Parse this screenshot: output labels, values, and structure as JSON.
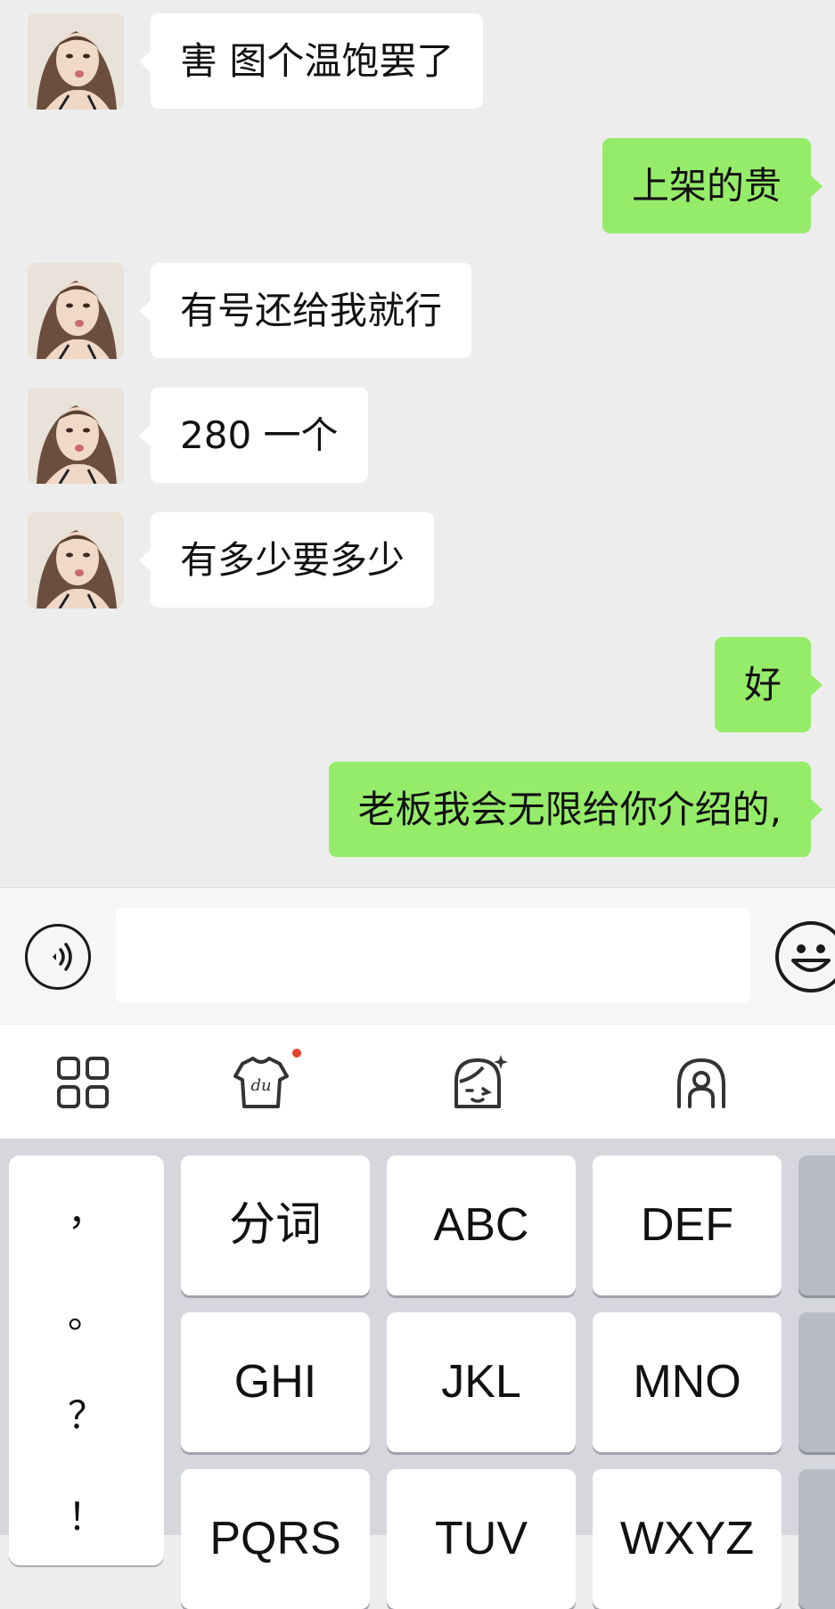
{
  "messages": [
    {
      "side": "in",
      "text": "害 图个温饱罢了"
    },
    {
      "side": "out",
      "text": "上架的贵"
    },
    {
      "side": "in",
      "text": "有号还给我就行"
    },
    {
      "side": "in",
      "text": "280 一个"
    },
    {
      "side": "in",
      "text": "有多少要多少"
    },
    {
      "side": "out",
      "text": "好"
    },
    {
      "side": "out",
      "text": "老板我会无限给你介绍的,"
    }
  ],
  "input": {
    "value": "",
    "voice_icon": "voice-input-icon",
    "emoji_icon": "emoji-icon"
  },
  "keyboard_toolbar": {
    "items": [
      "apps-grid-icon",
      "du-skin-icon",
      "face-sticker-icon",
      "ime-logo-icon"
    ],
    "badge_color": "#e2452e"
  },
  "keyboard": {
    "punctuation": [
      "，",
      "。",
      "？",
      "！"
    ],
    "keys": [
      [
        "分词",
        "ABC",
        "DEF"
      ],
      [
        "GHI",
        "JKL",
        "MNO"
      ],
      [
        "PQRS",
        "TUV",
        "WXYZ"
      ]
    ]
  },
  "colors": {
    "chat_bg": "#ededed",
    "incoming_bubble": "#ffffff",
    "outgoing_bubble": "#95ec69",
    "keyboard_bg": "#d5d7dd"
  }
}
